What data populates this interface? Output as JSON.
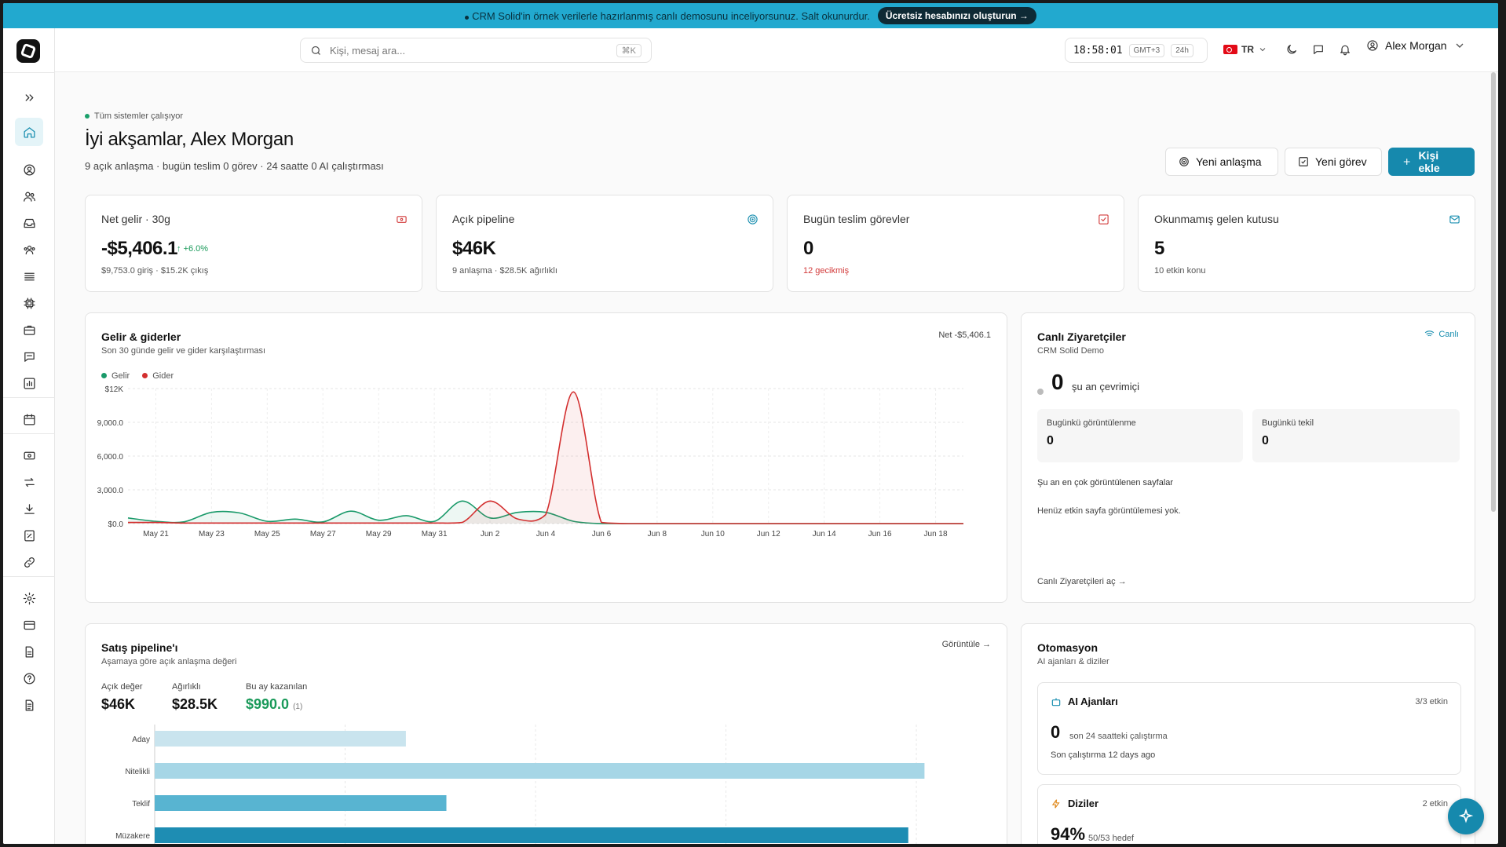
{
  "banner": {
    "text": "CRM Solid'in örnek verilerle hazırlanmış canlı demosunu inceliyorsunuz. Salt okunurdur.",
    "cta": "Ücretsiz hesabınızı oluşturun →"
  },
  "search": {
    "placeholder": "Kişi, mesaj ara...",
    "shortcut": "⌘K"
  },
  "clock": {
    "time": "18:58:01",
    "tz": "GMT+3",
    "format": "24h"
  },
  "lang": {
    "code": "TR"
  },
  "user": {
    "name": "Alex Morgan"
  },
  "header": {
    "status": "Tüm sistemler çalışıyor",
    "greeting": "İyi akşamlar, Alex Morgan",
    "summary": "9 açık anlaşma · bugün teslim 0 görev · 24 saatte 0 AI çalıştırması",
    "new_deal": "Yeni anlaşma",
    "new_task": "Yeni görev",
    "add_contact": "Kişi ekle"
  },
  "kpis": [
    {
      "label": "Net gelir · 30g",
      "value": "-$5,406.1",
      "delta": "+6.0%",
      "note": "$9,753.0 giriş · $15.2K çıkış",
      "icon": "money-icon",
      "color": "#d23a3a"
    },
    {
      "label": "Açık pipeline",
      "value": "$46K",
      "note": "9 anlaşma · $28.5K ağırlıklı",
      "icon": "target-icon",
      "color": "#1a8fb0"
    },
    {
      "label": "Bugün teslim görevler",
      "value": "0",
      "note": "12 gecikmiş",
      "icon": "check-square-icon",
      "color": "#d23a3a"
    },
    {
      "label": "Okunmamış gelen kutusu",
      "value": "5",
      "note": "10 etkin konu",
      "icon": "mail-icon",
      "color": "#1a8fb0"
    }
  ],
  "income": {
    "title": "Gelir & giderler",
    "subtitle": "Son 30 günde gelir ve gider karşılaştırması",
    "net": "Net -$5,406.1",
    "legend_income": "Gelir",
    "legend_expense": "Gider"
  },
  "chart_data": {
    "type": "area",
    "x": [
      "May 20",
      "May 21",
      "May 22",
      "May 23",
      "May 24",
      "May 25",
      "May 26",
      "May 27",
      "May 28",
      "May 29",
      "May 30",
      "May 31",
      "Jun 1",
      "Jun 2",
      "Jun 3",
      "Jun 4",
      "Jun 5",
      "Jun 6",
      "Jun 7",
      "Jun 8",
      "Jun 9",
      "Jun 10",
      "Jun 11",
      "Jun 12",
      "Jun 13",
      "Jun 14",
      "Jun 15",
      "Jun 16",
      "Jun 17",
      "Jun 18",
      "Jun 19"
    ],
    "x_tick_labels": [
      "May 21",
      "May 23",
      "May 25",
      "May 27",
      "May 29",
      "May 31",
      "Jun 2",
      "Jun 4",
      "Jun 6",
      "Jun 8",
      "Jun 10",
      "Jun 12",
      "Jun 14",
      "Jun 16",
      "Jun 18"
    ],
    "y_tick_labels": [
      "$0.0",
      "3,000.0",
      "6,000.0",
      "9,000.0",
      "$12K"
    ],
    "ylim": [
      0,
      12000
    ],
    "series": [
      {
        "name": "Gelir",
        "color": "#1a9a6a",
        "values": [
          500,
          200,
          150,
          1000,
          950,
          200,
          400,
          150,
          1100,
          300,
          700,
          200,
          2000,
          500,
          1000,
          1000,
          200,
          0,
          0,
          0,
          0,
          0,
          0,
          0,
          0,
          0,
          0,
          0,
          0,
          0,
          0
        ]
      },
      {
        "name": "Gider",
        "color": "#d32f2f",
        "values": [
          100,
          100,
          50,
          50,
          50,
          50,
          50,
          50,
          50,
          50,
          50,
          50,
          100,
          2000,
          400,
          800,
          11700,
          100,
          0,
          0,
          0,
          0,
          0,
          0,
          0,
          0,
          0,
          0,
          0,
          0,
          0
        ]
      }
    ],
    "grid": true
  },
  "live": {
    "title": "Canlı Ziyaretçiler",
    "subtitle": "CRM Solid Demo",
    "badge": "Canlı",
    "online_count": "0",
    "online_label": "şu an çevrimiçi",
    "views_label": "Bugünkü görüntülenme",
    "views_value": "0",
    "unique_label": "Bugünkü tekil",
    "unique_value": "0",
    "top_pages": "Şu an en çok görüntülenen sayfalar",
    "empty": "Henüz etkin sayfa görüntülemesi yok.",
    "open_link": "Canlı Ziyaretçileri aç →"
  },
  "pipeline": {
    "title": "Satış pipeline'ı",
    "subtitle": "Aşamaya göre açık anlaşma değeri",
    "view_link": "Görüntüle →",
    "open_label": "Açık değer",
    "open_value": "$46K",
    "weighted_label": "Ağırlıklı",
    "weighted_value": "$28.5K",
    "won_label": "Bu ay kazanılan",
    "won_value": "$990.0",
    "won_count": "(1)",
    "stages": [
      {
        "label": "Aday",
        "value": 0.31,
        "color": "#c9e4ee"
      },
      {
        "label": "Nitelikli",
        "value": 0.95,
        "color": "#a6d6e6"
      },
      {
        "label": "Teklif",
        "value": 0.36,
        "color": "#58b4d1"
      },
      {
        "label": "Müzakere",
        "value": 0.93,
        "color": "#1e8db3"
      }
    ]
  },
  "automation": {
    "title": "Otomasyon",
    "subtitle": "AI ajanları & diziler",
    "agents_title": "AI Ajanları",
    "agents_right": "3/3 etkin",
    "agents_num": "0",
    "agents_num_label": "son 24 saatteki çalıştırma",
    "agents_last": "Son çalıştırma 12 days ago",
    "seq_title": "Diziler",
    "seq_right": "2 etkin",
    "seq_num": "94%",
    "seq_num_label": "50/53 hedef"
  }
}
